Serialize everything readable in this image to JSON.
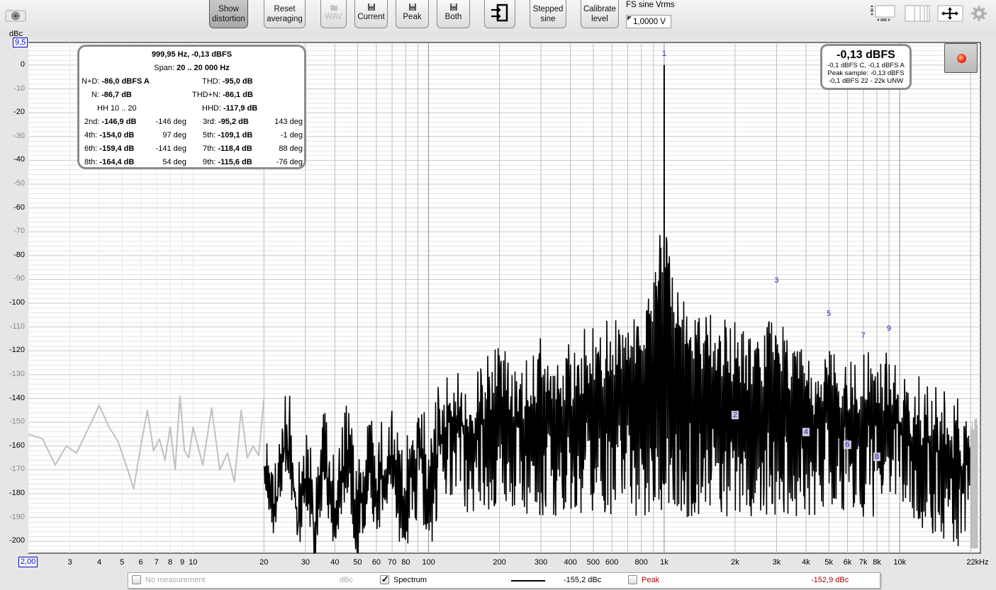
{
  "toolbar": {
    "camera_icon": "camera-icon",
    "buttons": [
      {
        "id": "show-distortion",
        "label1": "Show",
        "label2": "distortion",
        "active": true
      },
      {
        "id": "reset-averaging",
        "label1": "Reset",
        "label2": "averaging"
      },
      {
        "id": "wav",
        "label": "WAV",
        "icon": "folder-icon",
        "disabled": true
      },
      {
        "id": "current",
        "label": "Current",
        "icon": "floppy-icon"
      },
      {
        "id": "peak",
        "label": "Peak",
        "icon": "floppy-icon"
      },
      {
        "id": "both",
        "label": "Both",
        "icon": "floppy-icon"
      },
      {
        "id": "input",
        "icon": "input-arrows-icon"
      },
      {
        "id": "stepped-sine",
        "label1": "Stepped",
        "label2": "sine"
      },
      {
        "id": "calibrate-level",
        "label1": "Calibrate",
        "label2": "level"
      }
    ],
    "fs_label": "FS sine Vrms",
    "fs_value": "1,0000 V",
    "right_icons": [
      "resize-panel-icon",
      "columns-icon",
      "pan-arrows-icon",
      "gear-icon"
    ]
  },
  "info_panel": {
    "title": "999,95 Hz, -0,13 dBFS",
    "span_label": "Span:",
    "span_value": "20 .. 20 000 Hz",
    "nd_label": "N+D:",
    "nd_value": "-86,0 dBFS A",
    "thd_label": "THD:",
    "thd_value": "-95,0 dB",
    "n_label": "N:",
    "n_value": "-86,7 dB",
    "thdn_label": "THD+N:",
    "thdn_value": "-86,1 dB",
    "hh_label": "HH 10 .. 20",
    "hhd_label": "HHD:",
    "hhd_value": "-117,9 dB",
    "harmonics": [
      {
        "label": "2nd:",
        "value": "-146,9 dB",
        "phase": "-146 deg"
      },
      {
        "label": "3rd:",
        "value": "-95,2 dB",
        "phase": "143 deg"
      },
      {
        "label": "4th:",
        "value": "-154,0 dB",
        "phase": "97 deg"
      },
      {
        "label": "5th:",
        "value": "-109,1 dB",
        "phase": "-1 deg"
      },
      {
        "label": "6th:",
        "value": "-159,4 dB",
        "phase": "-141 deg"
      },
      {
        "label": "7th:",
        "value": "-118,4 dB",
        "phase": "88 deg"
      },
      {
        "label": "8th:",
        "value": "-164,4 dB",
        "phase": "54 deg"
      },
      {
        "label": "9th:",
        "value": "-115,6 dB",
        "phase": "-76 deg"
      }
    ]
  },
  "level_panel": {
    "main": "-0,13 dBFS",
    "line1": "-0,1 dBFS C, -0,1 dBFS A",
    "line2": "Peak sample: -0,13 dBFS",
    "line3": "-0,1 dBFS 22 - 22k UNW"
  },
  "record_button": "record-icon",
  "legend": {
    "no_measurement": "No measurement",
    "no_measurement_unit": "dBc",
    "spectrum_label": "Spectrum",
    "spectrum_checked": true,
    "spectrum_value": "-155,2 dBc",
    "peak_label": "Peak",
    "peak_checked": false,
    "peak_value": "-152,9 dBc",
    "peak_color": "#b00000"
  },
  "chart_data": {
    "type": "line",
    "title": "",
    "xlabel": "Hz",
    "ylabel": "dBc",
    "x_scale": "log",
    "xlim": [
      2,
      22000
    ],
    "ylim": [
      -205,
      9.5
    ],
    "y_top_readout": "9,5",
    "x_left_readout": "2,00",
    "y_ticks": [
      "0",
      "-10",
      "-20",
      "-30",
      "-40",
      "-50",
      "-60",
      "-70",
      "-80",
      "-90",
      "-100",
      "-110",
      "-120",
      "-130",
      "-140",
      "-150",
      "-160",
      "-170",
      "-180",
      "-190",
      "-200"
    ],
    "y_tick_values": [
      0,
      -10,
      -20,
      -30,
      -40,
      -50,
      -60,
      -70,
      -80,
      -90,
      -100,
      -110,
      -120,
      -130,
      -140,
      -150,
      -160,
      -170,
      -180,
      -190,
      -200
    ],
    "x_ticks": [
      {
        "v": 3,
        "t": "3"
      },
      {
        "v": 4,
        "t": "4"
      },
      {
        "v": 5,
        "t": "5"
      },
      {
        "v": 6,
        "t": "6"
      },
      {
        "v": 7,
        "t": "7"
      },
      {
        "v": 8,
        "t": "8"
      },
      {
        "v": 9,
        "t": "9"
      },
      {
        "v": 10,
        "t": "10"
      },
      {
        "v": 20,
        "t": "20"
      },
      {
        "v": 30,
        "t": "30"
      },
      {
        "v": 40,
        "t": "40"
      },
      {
        "v": 50,
        "t": "50"
      },
      {
        "v": 60,
        "t": "60"
      },
      {
        "v": 70,
        "t": "70"
      },
      {
        "v": 80,
        "t": "80"
      },
      {
        "v": 100,
        "t": "100"
      },
      {
        "v": 200,
        "t": "200"
      },
      {
        "v": 300,
        "t": "300"
      },
      {
        "v": 400,
        "t": "400"
      },
      {
        "v": 500,
        "t": "500"
      },
      {
        "v": 600,
        "t": "600"
      },
      {
        "v": 800,
        "t": "800"
      },
      {
        "v": 1000,
        "t": "1k"
      },
      {
        "v": 2000,
        "t": "2k"
      },
      {
        "v": 3000,
        "t": "3k"
      },
      {
        "v": 4000,
        "t": "4k"
      },
      {
        "v": 5000,
        "t": "5k"
      },
      {
        "v": 6000,
        "t": "6k"
      },
      {
        "v": 7000,
        "t": "7k"
      },
      {
        "v": 8000,
        "t": "8k"
      },
      {
        "v": 10000,
        "t": "10k"
      },
      {
        "v": 22000,
        "t": "22kHz"
      }
    ],
    "grid": true,
    "series": [
      {
        "name": "Spectrum (out of span, grey)",
        "color": "#c0c0c0",
        "x": [
          2,
          2.3,
          2.6,
          2.9,
          3.2,
          3.5,
          4,
          4.4,
          4.8,
          5.2,
          5.6,
          6,
          6.4,
          6.8,
          7.2,
          7.6,
          8,
          8.4,
          8.8,
          9.2,
          9.6,
          10,
          11,
          12,
          13,
          14,
          15,
          16,
          17,
          18,
          19,
          20
        ],
        "y": [
          -155,
          -157,
          -168,
          -160,
          -163,
          -155,
          -143,
          -152,
          -158,
          -168,
          -178,
          -160,
          -145,
          -162,
          -157,
          -166,
          -152,
          -170,
          -139,
          -162,
          -165,
          -152,
          -168,
          -144,
          -170,
          -163,
          -175,
          -145,
          -165,
          -160,
          -164,
          -140
        ]
      },
      {
        "name": "Spectrum",
        "color": "#000000",
        "value_label": "-155,2 dBc",
        "x": [
          20,
          22,
          25,
          28,
          30,
          33,
          36,
          40,
          45,
          50,
          55,
          60,
          70,
          80,
          90,
          100,
          120,
          150,
          200,
          250,
          300,
          400,
          500,
          600,
          700,
          800,
          900,
          950,
          1000,
          1050,
          1100,
          1200,
          1500,
          2000,
          2500,
          3000,
          3500,
          4000,
          4500,
          5000,
          6000,
          7000,
          8000,
          9000,
          10000,
          15000,
          20000,
          22000
        ],
        "y": [
          -140,
          -160,
          -129,
          -165,
          -143,
          -170,
          -138,
          -160,
          -133,
          -165,
          -145,
          -150,
          -140,
          -155,
          -135,
          -150,
          -120,
          -130,
          -113,
          -125,
          -110,
          -115,
          -107,
          -105,
          -100,
          -95,
          -80,
          -70,
          0,
          -72,
          -80,
          -95,
          -100,
          -105,
          -110,
          -95,
          -110,
          -112,
          -120,
          -108,
          -118,
          -118,
          -122,
          -115,
          -125,
          -135,
          -140,
          -145
        ]
      }
    ],
    "harmonic_markers": [
      {
        "n": "1",
        "freq": 1000,
        "db": 0
      },
      {
        "n": "2",
        "freq": 2000,
        "db": -146.9
      },
      {
        "n": "3",
        "freq": 3000,
        "db": -95.2
      },
      {
        "n": "4",
        "freq": 4000,
        "db": -154.0
      },
      {
        "n": "5",
        "freq": 5000,
        "db": -109.1
      },
      {
        "n": "6",
        "freq": 6000,
        "db": -159.4
      },
      {
        "n": "7",
        "freq": 7000,
        "db": -118.4
      },
      {
        "n": "8",
        "freq": 8000,
        "db": -164.4
      },
      {
        "n": "9",
        "freq": 9000,
        "db": -115.6
      }
    ]
  }
}
